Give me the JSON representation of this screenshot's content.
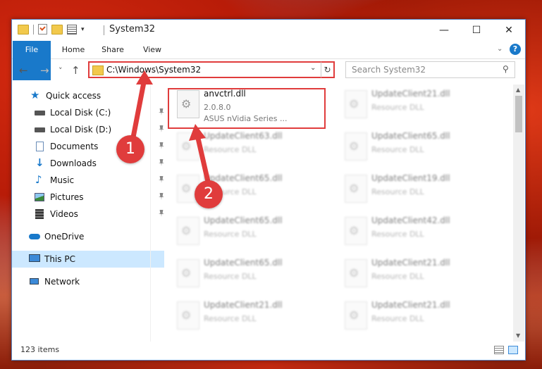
{
  "window": {
    "title": "System32",
    "controls": {
      "minimize": "—",
      "maximize": "☐",
      "close": "✕"
    }
  },
  "ribbon": {
    "tabs": [
      "File",
      "Home",
      "Share",
      "View"
    ]
  },
  "navigation": {
    "back": "←",
    "forward": "→",
    "recent": "˅",
    "up": "↑",
    "address": "C:\\Windows\\System32",
    "refresh": "↻",
    "search_placeholder": "Search System32"
  },
  "sidebar": {
    "items": [
      {
        "label": "Quick access",
        "icon": "star-icon",
        "pinned": false
      },
      {
        "label": "Local Disk (C:)",
        "icon": "drive-icon",
        "pinned": true
      },
      {
        "label": "Local Disk (D:)",
        "icon": "drive-icon",
        "pinned": true
      },
      {
        "label": "Documents",
        "icon": "documents-icon",
        "pinned": true
      },
      {
        "label": "Downloads",
        "icon": "download-icon",
        "pinned": true
      },
      {
        "label": "Music",
        "icon": "music-icon",
        "pinned": true
      },
      {
        "label": "Pictures",
        "icon": "pictures-icon",
        "pinned": true
      },
      {
        "label": "Videos",
        "icon": "videos-icon",
        "pinned": true
      },
      {
        "label": "OneDrive",
        "icon": "cloud-icon",
        "pinned": false
      },
      {
        "label": "This PC",
        "icon": "computer-icon",
        "pinned": false,
        "selected": true
      },
      {
        "label": "Network",
        "icon": "network-icon",
        "pinned": false
      }
    ]
  },
  "files": [
    {
      "name": "anvctrl.dll",
      "line2": "2.0.8.0",
      "line3": "ASUS nVidia Series ..."
    },
    {
      "name": "UpdateClient21.dll",
      "line2": "Resource DLL"
    },
    {
      "name": "UpdateClient63.dll",
      "line2": "Resource DLL"
    },
    {
      "name": "UpdateClient65.dll",
      "line2": "Resource DLL"
    },
    {
      "name": "UpdateClient65.dll",
      "line2": "Resource DLL"
    },
    {
      "name": "UpdateClient19.dll",
      "line2": "Resource DLL"
    },
    {
      "name": "UpdateClient65.dll",
      "line2": "Resource DLL"
    },
    {
      "name": "UpdateClient42.dll",
      "line2": "Resource DLL"
    },
    {
      "name": "UpdateClient65.dll",
      "line2": "Resource DLL"
    },
    {
      "name": "UpdateClient21.dll",
      "line2": "Resource DLL"
    },
    {
      "name": "UpdateClient21.dll",
      "line2": "Resource DLL"
    },
    {
      "name": "UpdateClient21.dll",
      "line2": "Resource DLL"
    }
  ],
  "status": {
    "item_count": "123 items"
  },
  "callouts": {
    "one": "1",
    "two": "2"
  },
  "colors": {
    "accent": "#1979ca",
    "highlight": "#e03c3c"
  }
}
